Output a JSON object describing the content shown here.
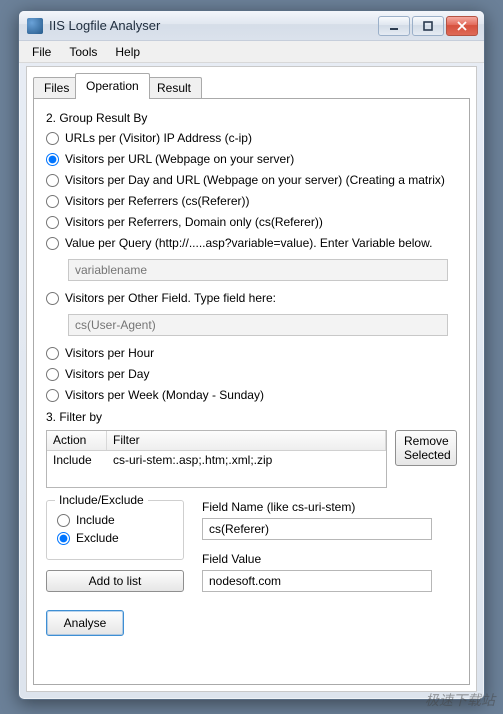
{
  "window": {
    "title": "IIS Logfile Analyser"
  },
  "menubar": [
    "File",
    "Tools",
    "Help"
  ],
  "tabs": {
    "items": [
      "Files",
      "Operation",
      "Result"
    ],
    "active": 1
  },
  "group": {
    "heading": "2. Group Result By",
    "options": [
      "URLs per (Visitor) IP Address (c-ip)",
      "Visitors per URL (Webpage on your server)",
      "Visitors per Day and URL (Webpage on your server) (Creating a matrix)",
      "Visitors per Referrers (cs(Referer))",
      "Visitors per Referrers, Domain only (cs(Referer))",
      "Value per Query (http://.....asp?variable=value). Enter Variable below.",
      "Visitors per Other Field. Type field here:",
      "Visitors per Hour",
      "Visitors per Day",
      "Visitors per Week (Monday - Sunday)"
    ],
    "selected": 1,
    "variable_placeholder": "variablename",
    "otherfield_placeholder": "cs(User-Agent)"
  },
  "filter": {
    "heading": "3. Filter by",
    "columns": {
      "action": "Action",
      "filter": "Filter"
    },
    "rows": [
      {
        "action": "Include",
        "filter": "cs-uri-stem:.asp;.htm;.xml;.zip"
      }
    ],
    "remove_label": "Remove Selected"
  },
  "ie": {
    "legend": "Include/Exclude",
    "include_label": "Include",
    "exclude_label": "Exclude",
    "selected": "exclude",
    "add_label": "Add to list"
  },
  "fields": {
    "name_label": "Field Name (like cs-uri-stem)",
    "name_value": "cs(Referer)",
    "value_label": "Field Value",
    "value_value": "nodesoft.com"
  },
  "analyse_label": "Analyse",
  "watermark": "极速下载站"
}
